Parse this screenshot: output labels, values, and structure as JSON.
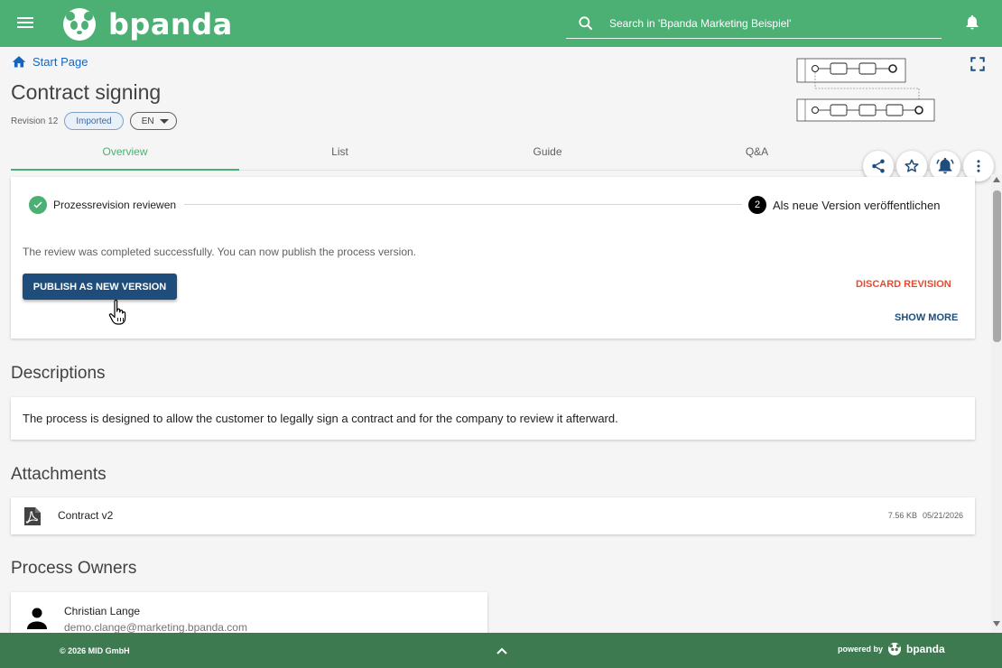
{
  "app": {
    "brand": "bpanda"
  },
  "search": {
    "placeholder": "Search in 'Bpanda Marketing Beispiel'"
  },
  "breadcrumb": {
    "label": "Start Page"
  },
  "process": {
    "title": "Contract signing",
    "revision": "Revision 12",
    "status": "Imported",
    "language": "EN"
  },
  "tabs": [
    {
      "label": "Overview",
      "active": true
    },
    {
      "label": "List",
      "active": false
    },
    {
      "label": "Guide",
      "active": false
    },
    {
      "label": "Q&A",
      "active": false
    }
  ],
  "actions": [
    "share-icon",
    "star-icon",
    "bell-icon",
    "more-vert-icon"
  ],
  "review": {
    "step1": "Prozessrevision reviewen",
    "step2_number": "2",
    "step2": "Als neue Version veröffentlichen",
    "message": "The review was completed successfully. You can now publish the process version.",
    "publish_label": "PUBLISH AS NEW VERSION",
    "discard_label": "DISCARD REVISION",
    "show_more_label": "SHOW MORE"
  },
  "descriptions": {
    "title": "Descriptions",
    "text": "The process is designed to allow the customer to legally sign a contract and for the company to review it afterward."
  },
  "attachments": {
    "title": "Attachments",
    "items": [
      {
        "name": "Contract v2",
        "size": "7.56 KB",
        "date": "05/21/2026"
      }
    ]
  },
  "owners": {
    "title": "Process Owners",
    "items": [
      {
        "name": "Christian Lange",
        "email": "demo.clange@marketing.bpanda.com"
      }
    ]
  },
  "footer": {
    "copyright": "© 2026 MID GmbH",
    "powered_by": "powered by",
    "brand": "bpanda"
  },
  "colors": {
    "header_green": "#4caf73",
    "footer_green": "#3e7a50",
    "primary_navy": "#1e4d7b",
    "danger": "#e64a2e"
  }
}
